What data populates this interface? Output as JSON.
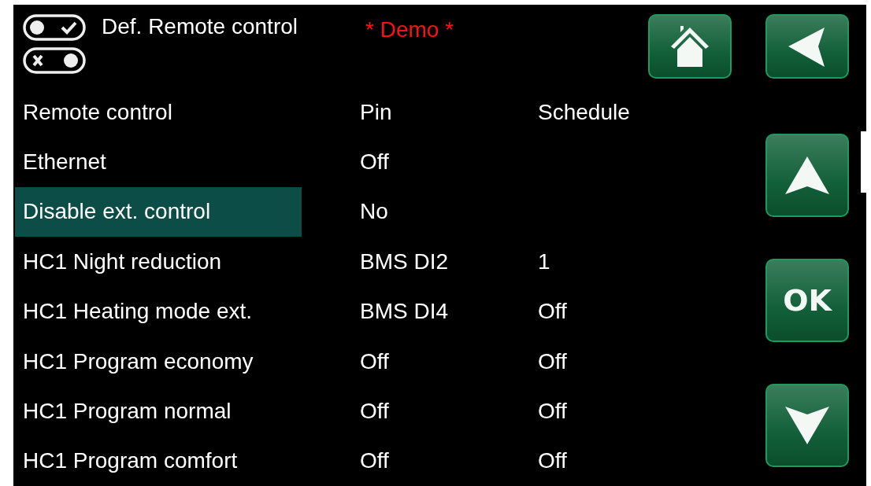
{
  "header": {
    "title": "Def. Remote control",
    "mode": "* Demo *"
  },
  "table": {
    "columns": [
      "Remote control",
      "Pin",
      "Schedule"
    ],
    "rows": [
      {
        "name": "Ethernet",
        "pin": "Off",
        "selected": false
      },
      {
        "name": "Disable ext. control",
        "pin": "No",
        "selected": true
      },
      {
        "name": "HC1 Night reduction",
        "pin": "BMS DI2",
        "schedule": "1",
        "selected": false
      },
      {
        "name": "HC1 Heating mode ext.",
        "pin": "BMS DI4",
        "schedule": "Off",
        "selected": false
      },
      {
        "name": "HC1 Program economy",
        "pin": "Off",
        "schedule": "Off",
        "selected": false
      },
      {
        "name": "HC1 Program normal",
        "pin": "Off",
        "schedule": "Off",
        "selected": false
      },
      {
        "name": "HC1 Program comfort",
        "pin": "Off",
        "schedule": "Off",
        "selected": false
      }
    ]
  },
  "nav_buttons": [
    {
      "kind": "up"
    },
    {
      "kind": "ok",
      "label": "OK"
    },
    {
      "kind": "down"
    }
  ]
}
